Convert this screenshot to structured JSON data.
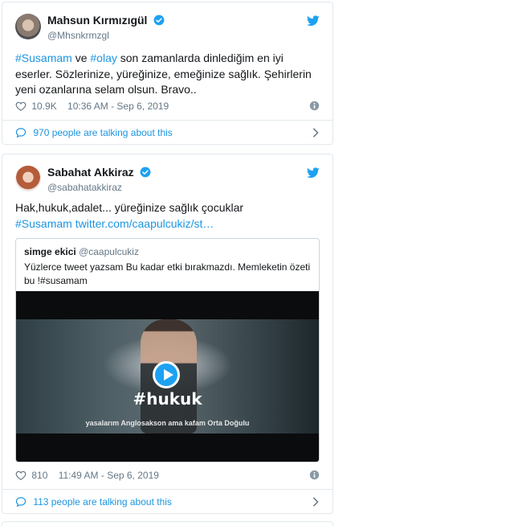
{
  "colors": {
    "link": "#1b95e0",
    "text": "#14171a",
    "muted": "#657786",
    "border": "#e1e8ed",
    "twitter_blue": "#1da1f2"
  },
  "tweets": [
    {
      "display_name": "Mahsun Kırmızıgül",
      "handle": "@Mhsnkrmzgl",
      "verified": true,
      "text": {
        "tag1": "#Susamam",
        "part1": " ve  ",
        "tag2": "#olay",
        "part2": " son zamanlarda dinlediğim en iyi eserler. Sözlerinize, yüreğinize, emeğinize sağlık.  Şehirlerin yeni ozanlarına selam olsun.  Bravo.."
      },
      "likes": "10.9K",
      "timestamp": "10:36 AM - Sep 6, 2019",
      "talking": "970 people are talking about this"
    },
    {
      "display_name": "Sabahat Akkiraz",
      "handle": "@sabahatakkiraz",
      "verified": true,
      "text": {
        "part1": "Hak,hukuk,adalet... yüreğinize sağlık çocuklar",
        "tag1": "#Susamam",
        "link": "twitter.com/caapulcukiz/st…"
      },
      "quote": {
        "name": "simge ekici",
        "handle": "@caapulcukiz",
        "text": "Yüzlerce tweet yazsam Bu kadar etki bırakmazdı. Memleketin özeti bu !#susamam",
        "video_hashtag": "#hukuk",
        "video_caption": "yasalarım Anglosakson ama kafam Orta Doğulu"
      },
      "likes": "810",
      "timestamp": "11:49 AM - Sep 6, 2019",
      "talking": "113 people are talking about this"
    }
  ]
}
